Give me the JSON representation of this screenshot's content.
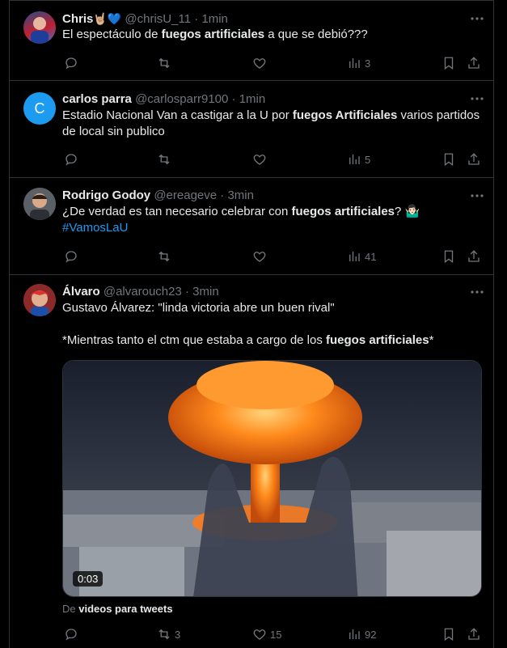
{
  "tweets": [
    {
      "name": "Chris",
      "name_emoji": "🤘🏼💙",
      "handle": "@chrisU_11",
      "time": "1min",
      "text_before": "El espectáculo de ",
      "text_bold": "fuegos artificiales",
      "text_after": " a que se debió???",
      "views": "3"
    },
    {
      "name": "carlos parra",
      "handle": "@carlosparr9100",
      "time": "1min",
      "avatar_letter": "C",
      "text_before": "Estadio Nacional Van a castigar a la U por ",
      "text_bold": "fuegos Artificiales",
      "text_after": " varios partidos de local sin publico",
      "views": "5"
    },
    {
      "name": "Rodrigo Godoy",
      "handle": "@ereageve",
      "time": "3min",
      "text_before": "¿De verdad es tan necesario celebrar con ",
      "text_bold": "fuegos artificiales",
      "text_after": "? 🤷🏻‍♂️",
      "hashtag": "#VamosLaU",
      "views": "41"
    },
    {
      "name": "Álvaro",
      "handle": "@alvarouch23",
      "time": "3min",
      "line1": "Gustavo Álvarez: \"linda victoria abre un buen rival\"",
      "line2_before": "*Mientras tanto el ctm que estaba a cargo de los ",
      "line2_bold": "fuegos artificiales",
      "line2_after": "*",
      "video_duration": "0:03",
      "source_prefix": "De ",
      "source_name": "videos para tweets",
      "retweets": "3",
      "likes": "15",
      "views": "92"
    }
  ],
  "separator": "·",
  "colors": {
    "accent": "#1d9bf0",
    "muted": "#71767b",
    "text": "#e7e9ea",
    "border": "#2f3336"
  },
  "icons": [
    "reply-icon",
    "retweet-icon",
    "like-icon",
    "views-icon",
    "bookmark-icon",
    "share-icon",
    "more-icon"
  ]
}
